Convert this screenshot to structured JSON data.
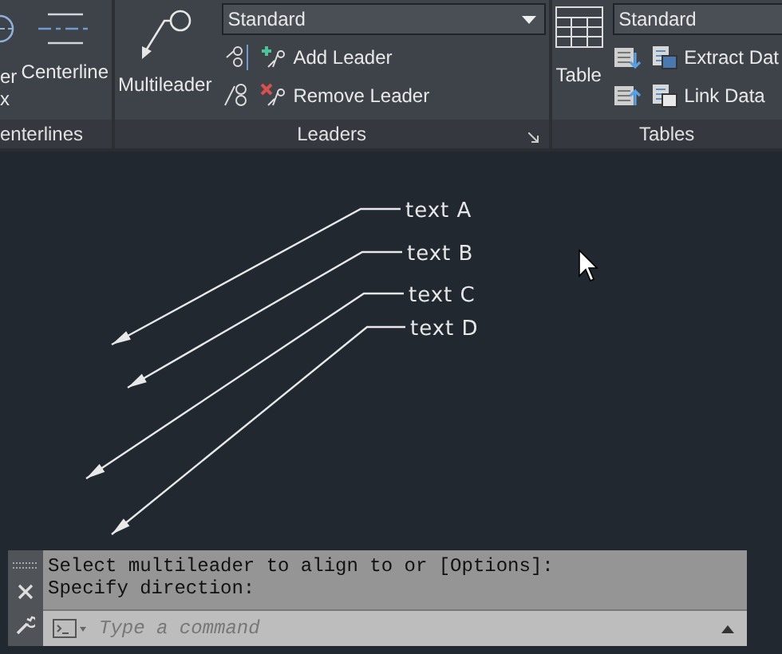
{
  "ribbon": {
    "panels": [
      {
        "kind": "centerlines",
        "partial_button_label": [
          "er",
          "x"
        ],
        "buttons": [
          "Centerline"
        ],
        "label": "enterlines"
      },
      {
        "kind": "leaders",
        "buttons": [
          "Multileader"
        ],
        "dropdown": {
          "value": "Standard"
        },
        "actions": [
          "Add Leader",
          "Remove Leader"
        ],
        "label": "Leaders"
      },
      {
        "kind": "tables",
        "buttons": [
          "Table"
        ],
        "dropdown": {
          "value": "Standard"
        },
        "actions": [
          "Extract Dat",
          "Link Data"
        ],
        "label": "Tables"
      }
    ]
  },
  "drawing": {
    "leaders": [
      {
        "text": "text A"
      },
      {
        "text": "text B"
      },
      {
        "text": "text C"
      },
      {
        "text": "text D"
      }
    ]
  },
  "command_line": {
    "history": [
      "Select multileader to align to or [Options]:",
      "Specify direction:"
    ],
    "input": {
      "placeholder": "Type a command"
    }
  }
}
